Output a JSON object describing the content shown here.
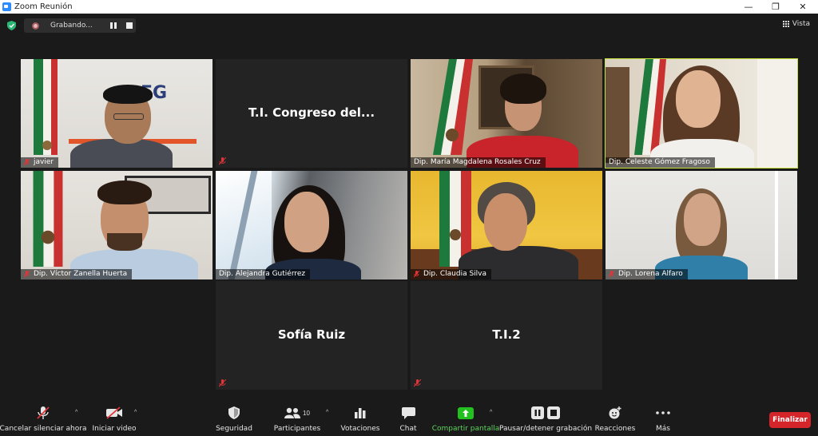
{
  "window": {
    "title": "Zoom Reunión",
    "minimize": "—",
    "restore": "❐",
    "close": "✕"
  },
  "recording": {
    "label": "Grabando..."
  },
  "view": {
    "label": "Vista"
  },
  "participants": [
    {
      "name": "javier",
      "muted": true
    },
    {
      "name": "T.I. Congreso del...",
      "muted": true,
      "video": false
    },
    {
      "name": "Dip. María Magdalena Rosales Cruz",
      "muted": false
    },
    {
      "name": "Dip. Celeste Gómez Fragoso",
      "muted": false,
      "speaking": true
    },
    {
      "name": "Dip. Víctor Zanella Huerta",
      "muted": true
    },
    {
      "name": "Dip. Alejandra Gutiérrez",
      "muted": false
    },
    {
      "name": "Dip. Claudia Silva",
      "muted": true
    },
    {
      "name": "Dip. Lorena Alfaro",
      "muted": true
    },
    {
      "name": "Sofía Ruiz",
      "muted": true,
      "video": false
    },
    {
      "name": "T.I.2",
      "muted": true,
      "video": false
    }
  ],
  "toolbar": {
    "unmute": "Cancelar silenciar ahora",
    "start_video": "Iniciar video",
    "security": "Seguridad",
    "participants": "Participantes",
    "participants_count": "10",
    "polls": "Votaciones",
    "chat": "Chat",
    "share": "Compartir pantalla",
    "record": "Pausar/detener grabación",
    "reactions": "Reacciones",
    "more": "Más",
    "end": "Finalizar"
  },
  "colors": {
    "background": "#1a1a1a",
    "active_speaker": "#c8e03a",
    "end_button": "#d4252b",
    "share_green": "#23c11f",
    "zoom_blue": "#2d8cff"
  }
}
